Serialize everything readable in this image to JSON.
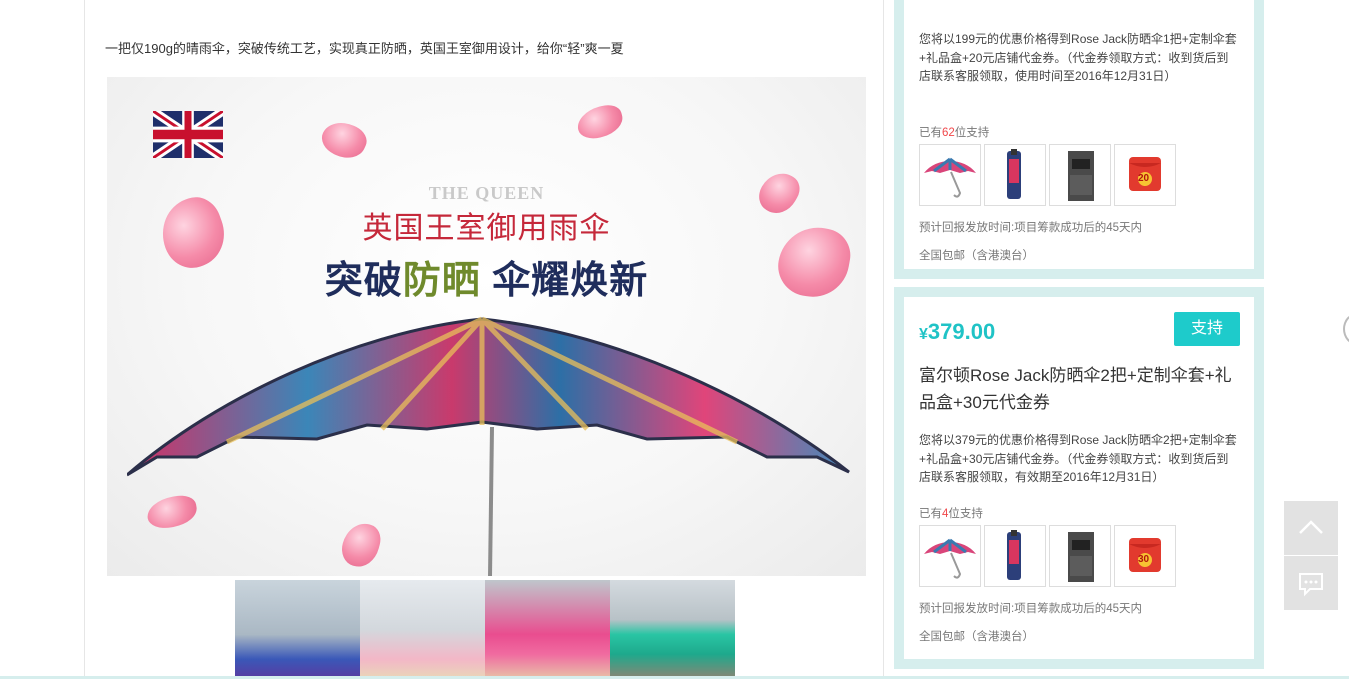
{
  "intro_text": "一把仅190g的晴雨伞，突破传统工艺，实现真正防晒，英国王室御用设计，给你“轻”爽一夏",
  "hero": {
    "brand_line": "THE QUEEN",
    "headline": "英国王室御用雨伞",
    "slogan_part1": "突破",
    "slogan_part2": "防晒",
    "slogan_part3": " 伞耀焕新"
  },
  "rewards": [
    {
      "description": "您将以199元的优惠价格得到Rose Jack防晒伞1把+定制伞套+礼品盒+20元店铺代金券。（代金券领取方式：收到货后到店联系客服领取，使用时间至2016年12月31日）",
      "backers_prefix": "已有",
      "backers_count": "62",
      "backers_suffix": "位支持",
      "voucher_value": "20",
      "delivery": "预计回报发放时间:项目筹款成功后的45天内",
      "shipping": "全国包邮（含港澳台）"
    },
    {
      "price_symbol": "¥",
      "price": "379.00",
      "support_label": "支持",
      "title": "富尔顿Rose Jack防晒伞2把+定制伞套+礼品盒+30元代金券",
      "description": "您将以379元的优惠价格得到Rose Jack防晒伞2把+定制伞套+礼品盒+30元店铺代金券。（代金券领取方式：收到货后到店联系客服领取，有效期至2016年12月31日）",
      "backers_prefix": "已有",
      "backers_count": "4",
      "backers_suffix": "位支持",
      "voucher_value": "30",
      "delivery": "预计回报发放时间:项目筹款成功后的45天内",
      "shipping": "全国包邮（含港澳台）"
    }
  ],
  "colors": {
    "accent": "#1ECBCB",
    "card_border": "#D6EEED",
    "backer_count": "#F0474A",
    "headline_red": "#C5283A",
    "slogan_navy": "#1F2D5C"
  },
  "icons": {
    "back_to_top": "chevron-up-icon",
    "chat": "chat-bubble-icon"
  }
}
